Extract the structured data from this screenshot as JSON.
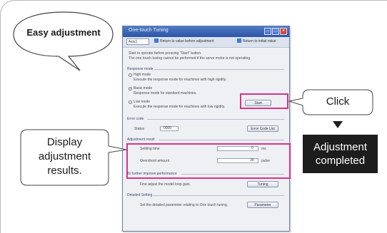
{
  "callouts": {
    "easy_adjustment": "Easy adjustment",
    "click": "Click",
    "display_results": [
      "Display",
      "adjustment",
      "results."
    ],
    "completed": [
      "Adjustment",
      "completed"
    ]
  },
  "dialog": {
    "title": "One-touch Tuning",
    "axis_select": "Axis1",
    "toolbar_return_value": "Return to value before adjustment",
    "toolbar_return_initial": "Return to initial value",
    "info_line1": "Start to operate before pressing \"Start\" button.",
    "info_line2": "The one touch tuning cannot be performed if the servo motor is not operating.",
    "response_mode_label": "Response mode",
    "modes": [
      {
        "name": "High mode",
        "desc": "Execute the response mode for machines with high rigidity."
      },
      {
        "name": "Basic mode",
        "desc": "Response mode for standard machines."
      },
      {
        "name": "Low mode",
        "desc": "Execute the response mode for machines with low rigidity."
      }
    ],
    "start_button": "Start",
    "error_code_label": "Error code",
    "status_label": "Status",
    "status_value": "0000",
    "error_code_list_button": "Error Code List",
    "adjustment_result_label": "Adjustment result",
    "settling_time_label": "Settling time",
    "settling_time_value": "0",
    "settling_time_unit": "ms",
    "overshoot_label": "Overshoot amount",
    "overshoot_value": "30",
    "overshoot_unit": "pulse",
    "further_improve_label": "To further improve performance",
    "fine_adjust_text": "Fine adjust the model loop gain.",
    "tuning_button": "Tuning",
    "detailed_setting_label": "Detailed Setting",
    "detailed_setting_text": "Set the detailed parameter relating to One touch tuning.",
    "parameter_button": "Parameter"
  },
  "colors": {
    "highlight": "#d9328c",
    "titlebar": "#2c56a6",
    "completed_box": "#1d1d1d"
  }
}
